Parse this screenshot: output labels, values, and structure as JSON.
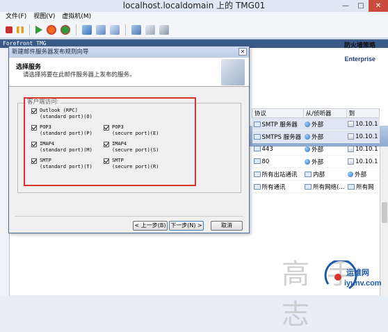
{
  "window": {
    "title": "localhost.localdomain 上的 TMG01"
  },
  "menu": [
    "文件(F)",
    "视图(V)",
    "虚拟机(M)"
  ],
  "toolbar_icons": [
    "stop-icon",
    "pause-icon",
    "play-icon",
    "reset-icon",
    "shutdown-icon",
    "snapshot-icon",
    "revert-icon",
    "manage-snapshots-icon",
    "send-keys-icon",
    "settings-icon",
    "connect-icon"
  ],
  "guest_header": "Forefront TMG",
  "policy": {
    "title": "防火墙策略",
    "edition": "Enterprise"
  },
  "wizard": {
    "title": "新建邮件服务器发布规则向导",
    "heading": "选择服务",
    "subtitle": "请选择将要在此邮件服务器上发布的服务。",
    "group_label": "客户端访问:",
    "checkboxes": [
      {
        "name": "Outlook (RPC)",
        "port": "(standard port)(O)",
        "checked": true
      },
      {
        "name": "POP3",
        "port": "(standard port)(P)",
        "checked": true
      },
      {
        "name": "IMAP4",
        "port": "(standard port)(M)",
        "checked": true
      },
      {
        "name": "SMTP",
        "port": "(standard port)(T)",
        "checked": true
      },
      {
        "name": "POP3",
        "port": "(secure port)(E)",
        "checked": true
      },
      {
        "name": "IMAP4",
        "port": "(secure port)(S)",
        "checked": true
      },
      {
        "name": "SMTP",
        "port": "(secure port)(R)",
        "checked": true
      }
    ],
    "buttons": {
      "back": "< 上一步(B)",
      "next": "下一步(N) >",
      "cancel": "取消"
    }
  },
  "rule_table": {
    "headers": [
      "协议",
      "从/侦听器",
      "到"
    ],
    "rows": [
      {
        "protocol": "SMTP 服务器",
        "from": "外部",
        "to": "10.10.1",
        "selected": true
      },
      {
        "protocol": "SMTPS 服务器",
        "from": "外部",
        "to": "10.10.1",
        "selected": true
      },
      {
        "protocol": "443",
        "from": "外部",
        "to": "10.10.1",
        "selected": false
      },
      {
        "protocol": "80",
        "from": "外部",
        "to": "10.10.1",
        "selected": false
      },
      {
        "protocol": "所有出站通讯",
        "from": "内部",
        "to": "外部",
        "selected": false
      },
      {
        "protocol": "所有通讯",
        "from": "所有网络(...",
        "to": "所有网",
        "selected": false
      }
    ]
  },
  "watermark": {
    "text": "高 手 志",
    "brand": "运维网",
    "url": "iyunv.com"
  },
  "colors": {
    "highlight": "#d9332c",
    "title_bar": "#3a5a88"
  }
}
